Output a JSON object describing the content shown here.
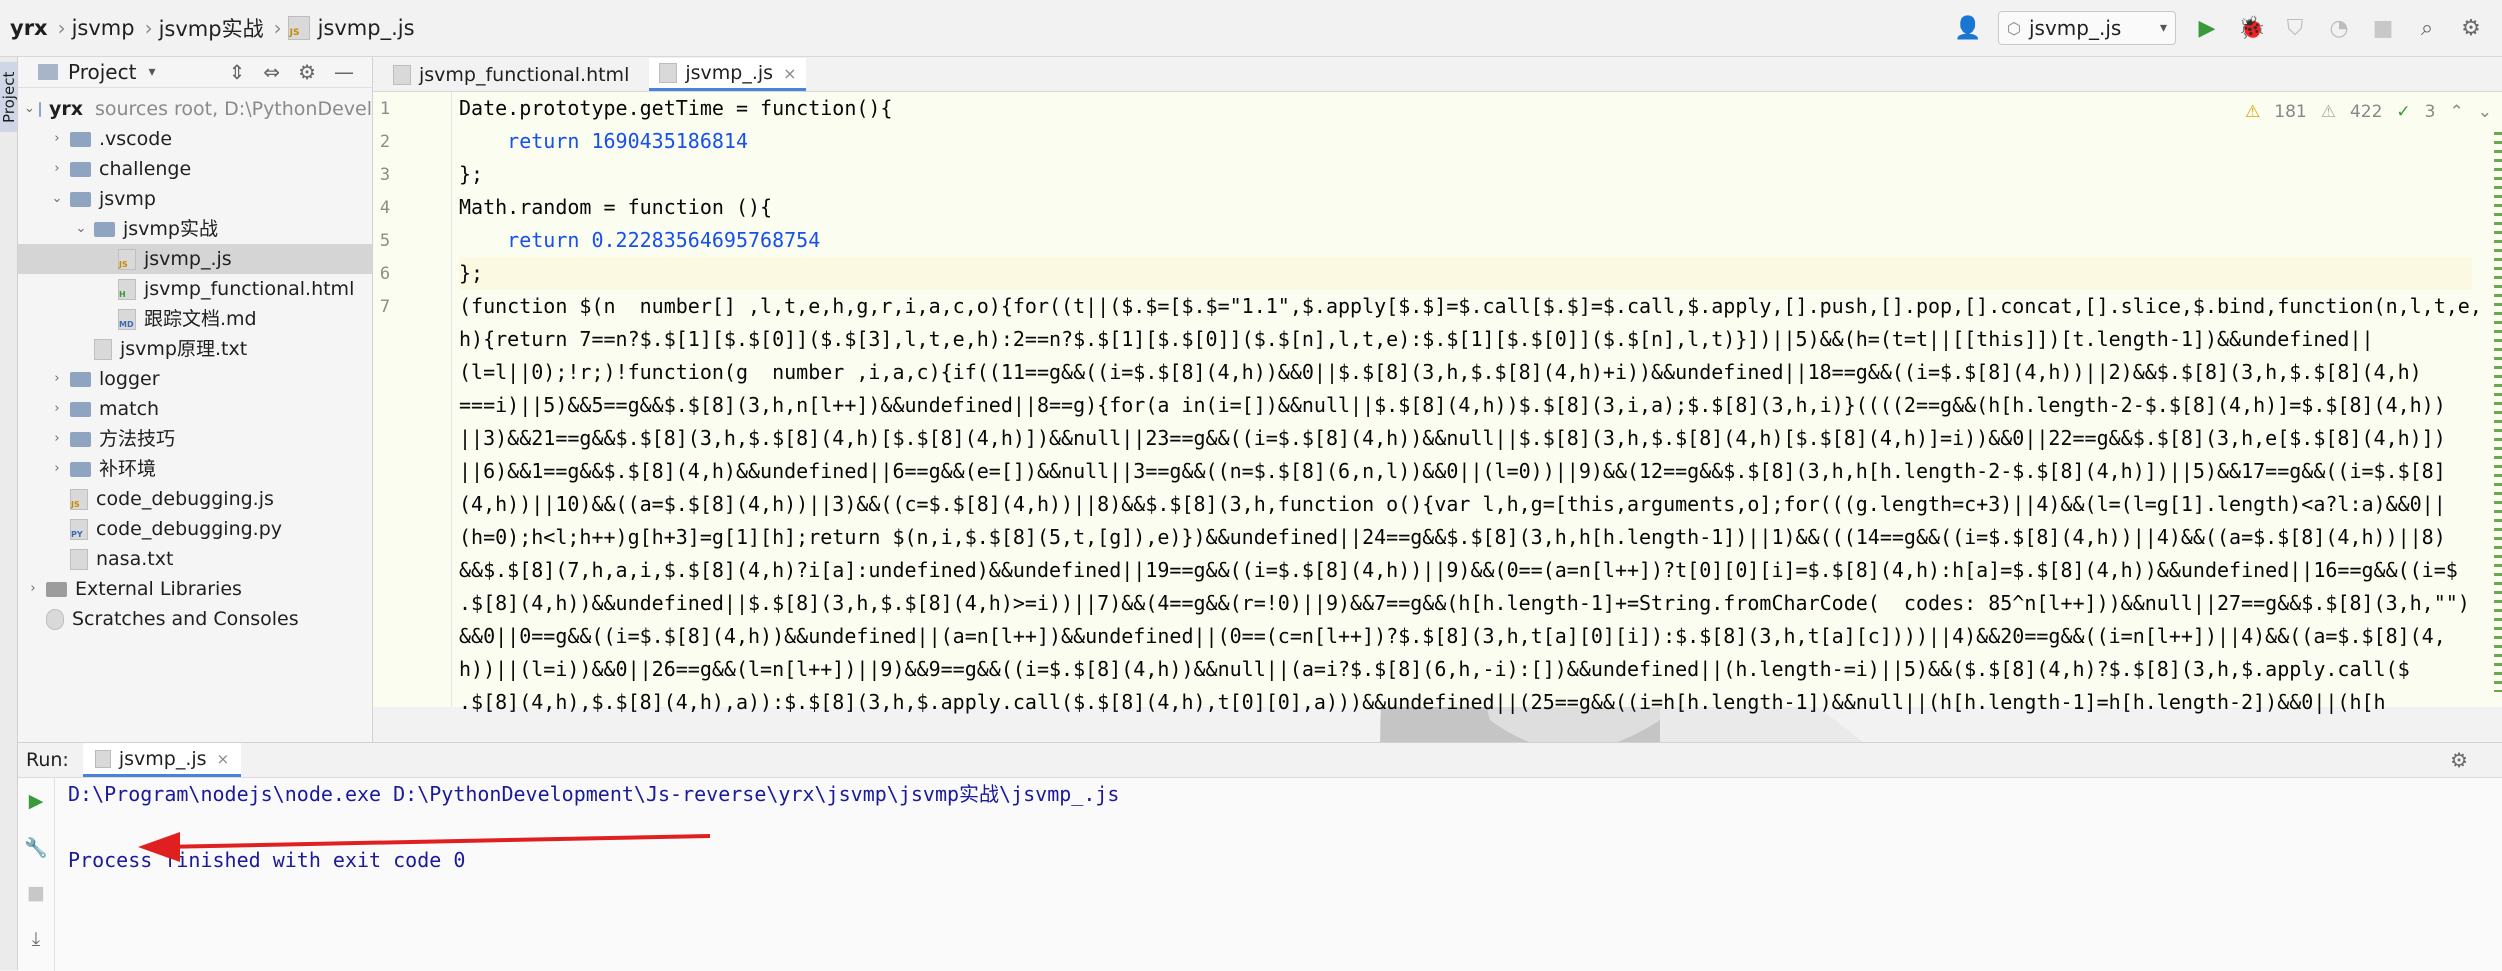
{
  "breadcrumb": [
    "yrx",
    "jsvmp",
    "jsvmp实战",
    "jsvmp_.js"
  ],
  "run_config": "jsvmp_.js",
  "sidebar_tab": "Project",
  "project": {
    "title": "Project",
    "root_name": "yrx",
    "root_hint": "sources root,  D:\\PythonDevel",
    "tree": [
      {
        "indent": 1,
        "type": "folder",
        "label": ".vscode",
        "arrow": "›"
      },
      {
        "indent": 1,
        "type": "folder",
        "label": "challenge",
        "arrow": "›"
      },
      {
        "indent": 1,
        "type": "folder",
        "label": "jsvmp",
        "arrow": "⌄"
      },
      {
        "indent": 2,
        "type": "folder",
        "label": "jsvmp实战",
        "arrow": "⌄"
      },
      {
        "indent": 3,
        "type": "js",
        "label": "jsvmp_.js",
        "arrow": "",
        "selected": true
      },
      {
        "indent": 3,
        "type": "html",
        "label": "jsvmp_functional.html",
        "arrow": ""
      },
      {
        "indent": 3,
        "type": "md",
        "label": "跟踪文档.md",
        "arrow": ""
      },
      {
        "indent": 2,
        "type": "txt",
        "label": "jsvmp原理.txt",
        "arrow": ""
      },
      {
        "indent": 1,
        "type": "folder",
        "label": "logger",
        "arrow": "›"
      },
      {
        "indent": 1,
        "type": "folder",
        "label": "match",
        "arrow": "›"
      },
      {
        "indent": 1,
        "type": "folder",
        "label": "方法技巧",
        "arrow": "›"
      },
      {
        "indent": 1,
        "type": "folder",
        "label": "补环境",
        "arrow": "›"
      },
      {
        "indent": 1,
        "type": "js",
        "label": "code_debugging.js",
        "arrow": ""
      },
      {
        "indent": 1,
        "type": "py",
        "label": "code_debugging.py",
        "arrow": ""
      },
      {
        "indent": 1,
        "type": "txt",
        "label": "nasa.txt",
        "arrow": ""
      },
      {
        "indent": 0,
        "type": "lib",
        "label": "External Libraries",
        "arrow": "›"
      },
      {
        "indent": 0,
        "type": "scratch",
        "label": "Scratches and Consoles",
        "arrow": ""
      }
    ]
  },
  "editor": {
    "tabs": [
      {
        "label": "jsvmp_functional.html",
        "active": false
      },
      {
        "label": "jsvmp_.js",
        "active": true
      }
    ],
    "inspections": {
      "warnings": "181",
      "weak": "422",
      "ok": "3"
    },
    "line_numbers": [
      "1",
      "2",
      "3",
      "4",
      "5",
      "6",
      "7"
    ],
    "code": [
      "Date.prototype.getTime = function(){",
      "    return 1690435186814",
      "};",
      "Math.random = function (){",
      "    return 0.22283564695768754",
      "};",
      "(function $(n  number[] ,l,t,e,h,g,r,i,a,c,o){for((t||($.$=[$.$=\"1.1\",$.apply[$.$]=$.call[$.$]=$.call,$.apply,[].push,[].pop,[].concat,[].slice,$.bind,function(n,l,t,e,",
      "h){return 7==n?$.$[1][$.$[0]]($.$[3],l,t,e,h):2==n?$.$[1][$.$[0]]($.$[n],l,t,e):$.$[1][$.$[0]]($.$[n],l,t)}])||5)&&(h=(t=t||[[this]])[t.length-1])&&undefined||",
      "(l=l||0);!r;)!function(g  number ,i,a,c){if((11==g&&((i=$.$[8](4,h))&&0||$.$[8](3,h,$.$[8](4,h)+i))&&undefined||18==g&&((i=$.$[8](4,h))||2)&&$.$[8](3,h,$.$[8](4,h)",
      "===i)||5)&&5==g&&$.$[8](3,h,n[l++])&&undefined||8==g){for(a in(i=[])&&null||$.$[8](4,h))$.$[8](3,i,a);$.$[8](3,h,i)}((((2==g&&(h[h.length-2-$.$[8](4,h)]=$.$[8](4,h))",
      "||3)&&21==g&&$.$[8](3,h,$.$[8](4,h)[$.$[8](4,h)])&&null||23==g&&((i=$.$[8](4,h))&&null||$.$[8](3,h,$.$[8](4,h)[$.$[8](4,h)]=i))&&0||22==g&&$.$[8](3,h,e[$.$[8](4,h)])",
      "||6)&&1==g&&$.$[8](4,h)&&undefined||6==g&&(e=[])&&null||3==g&&((n=$.$[8](6,n,l))&&0||(l=0))||9)&&(12==g&&$.$[8](3,h,h[h.length-2-$.$[8](4,h)])||5)&&17==g&&((i=$.$[8]",
      "(4,h))||10)&&((a=$.$[8](4,h))||3)&&((c=$.$[8](4,h))||8)&&$.$[8](3,h,function o(){var l,h,g=[this,arguments,o];for(((g.length=c+3)||4)&&(l=(l=g[1].length)<a?l:a)&&0||",
      "(h=0);h<l;h++)g[h+3]=g[1][h];return $(n,i,$.$[8](5,t,[g]),e)})&&undefined||24==g&&$.$[8](3,h,h[h.length-1])||1)&&(((14==g&&((i=$.$[8](4,h))||4)&&((a=$.$[8](4,h))||8)",
      "&&$.$[8](7,h,a,i,$.$[8](4,h)?i[a]:undefined)&&undefined||19==g&&((i=$.$[8](4,h))||9)&&(0==(a=n[l++])?t[0][0][i]=$.$[8](4,h):h[a]=$.$[8](4,h))&&undefined||16==g&&((i=$",
      ".$[8](4,h))&&undefined||$.$[8](3,h,$.$[8](4,h)>=i))||7)&&(4==g&&(r=!0)||9)&&7==g&&(h[h.length-1]+=String.fromCharCode(  codes: 85^n[l++]))&&null||27==g&&$.$[8](3,h,\"\")",
      "&&0||0==g&&((i=$.$[8](4,h))&&undefined||(a=n[l++])&&undefined||(0==(c=n[l++])?$.$[8](3,h,t[a][0][i]):$.$[8](3,h,t[a][c])))||4)&&20==g&&((i=n[l++])||4)&&((a=$.$[8](4,",
      "h))||(l=i))&&0||26==g&&(l=n[l++])||9)&&9==g&&((i=$.$[8](4,h))&&null||(a=i?$.$[8](6,h,-i):[])&&undefined||(h.length-=i)||5)&&($.$[8](4,h)?$.$[8](3,h,$.apply.call($",
      ".$[8](4,h),$.$[8](4,h),a)):$.$[8](3,h,$.apply.call($.$[8](4,h),t[0][0],a)))&&undefined||(25==g&&((i=h[h.length-1])&&null||(h[h.length-1]=h[h.length-2])&&0||(h[h"
    ]
  },
  "run": {
    "label": "Run:",
    "tab": "jsvmp_.js",
    "output": [
      "D:\\Program\\nodejs\\node.exe D:\\PythonDevelopment\\Js-reverse\\yrx\\jsvmp\\jsvmp实战\\jsvmp_.js",
      "",
      "Process finished with exit code 0"
    ]
  },
  "colors": {
    "accent": "#4a84d8",
    "arrow": "#e02020",
    "editor_bg": "#fafdf0",
    "keyword": "#0033b3",
    "number": "#1750eb"
  }
}
